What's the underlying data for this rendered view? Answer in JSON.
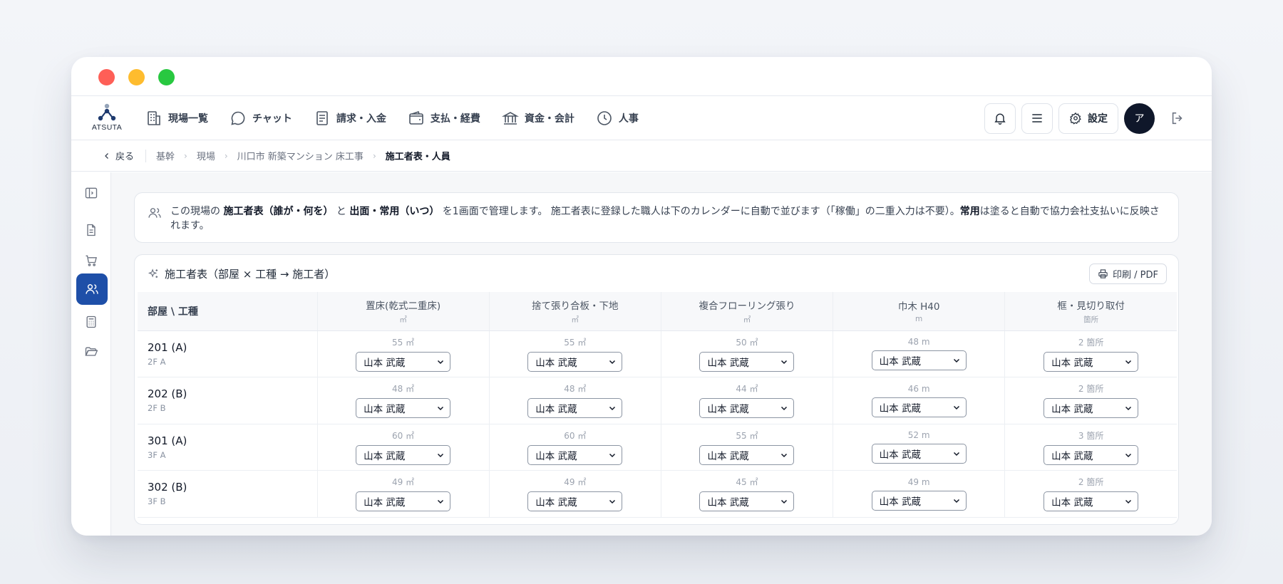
{
  "nav": {
    "logo_text": "ATSUTA",
    "items": [
      {
        "label": "現場一覧",
        "icon": "building-icon"
      },
      {
        "label": "チャット",
        "icon": "chat-bubble-icon"
      },
      {
        "label": "請求・入金",
        "icon": "invoice-icon"
      },
      {
        "label": "支払・経費",
        "icon": "wallet-icon"
      },
      {
        "label": "資金・会計",
        "icon": "bank-icon"
      },
      {
        "label": "人事",
        "icon": "clock-icon"
      }
    ],
    "settings_label": "設定",
    "avatar_initial": "ア"
  },
  "breadcrumb": {
    "back_label": "戻る",
    "items": [
      "基幹",
      "現場",
      "川口市 新築マンション 床工事"
    ],
    "current": "施工者表・人員"
  },
  "info": {
    "t1": "この現場の ",
    "b1": "施工者表（誰が・何を）",
    "t2": " と ",
    "b2": "出面・常用（いつ）",
    "t3": " を1画面で管理します。 施工者表に登録した職人は下のカレンダーに自動で並びます（「稼働」の二重入力は不要）。",
    "b3": "常用",
    "t4": "は塗ると自動で協力会社支払いに反映されます。"
  },
  "table_card": {
    "title": "施工者表（部屋 × 工種 → 施工者）",
    "print_label": "印刷 / PDF",
    "corner_header": "部屋 \\ 工種",
    "processes": [
      {
        "name": "置床(乾式二重床)",
        "unit": "㎡"
      },
      {
        "name": "捨て張り合板・下地",
        "unit": "㎡"
      },
      {
        "name": "複合フローリング張り",
        "unit": "㎡"
      },
      {
        "name": "巾木 H40",
        "unit": "m"
      },
      {
        "name": "框・見切り取付",
        "unit": "箇所"
      }
    ],
    "rows": [
      {
        "room": "201 (A)",
        "floor": "2F A",
        "cells": [
          {
            "qty": "55 ㎡",
            "worker": "山本 武蔵"
          },
          {
            "qty": "55 ㎡",
            "worker": "山本 武蔵"
          },
          {
            "qty": "50 ㎡",
            "worker": "山本 武蔵"
          },
          {
            "qty": "48 m",
            "worker": "山本 武蔵"
          },
          {
            "qty": "2 箇所",
            "worker": "山本 武蔵"
          }
        ]
      },
      {
        "room": "202 (B)",
        "floor": "2F B",
        "cells": [
          {
            "qty": "48 ㎡",
            "worker": "山本 武蔵"
          },
          {
            "qty": "48 ㎡",
            "worker": "山本 武蔵"
          },
          {
            "qty": "44 ㎡",
            "worker": "山本 武蔵"
          },
          {
            "qty": "46 m",
            "worker": "山本 武蔵"
          },
          {
            "qty": "2 箇所",
            "worker": "山本 武蔵"
          }
        ]
      },
      {
        "room": "301 (A)",
        "floor": "3F A",
        "cells": [
          {
            "qty": "60 ㎡",
            "worker": "山本 武蔵"
          },
          {
            "qty": "60 ㎡",
            "worker": "山本 武蔵"
          },
          {
            "qty": "55 ㎡",
            "worker": "山本 武蔵"
          },
          {
            "qty": "52 m",
            "worker": "山本 武蔵"
          },
          {
            "qty": "3 箇所",
            "worker": "山本 武蔵"
          }
        ]
      },
      {
        "room": "302 (B)",
        "floor": "3F B",
        "cells": [
          {
            "qty": "49 ㎡",
            "worker": "山本 武蔵"
          },
          {
            "qty": "49 ㎡",
            "worker": "山本 武蔵"
          },
          {
            "qty": "45 ㎡",
            "worker": "山本 武蔵"
          },
          {
            "qty": "49 m",
            "worker": "山本 武蔵"
          },
          {
            "qty": "2 箇所",
            "worker": "山本 武蔵"
          }
        ]
      }
    ]
  },
  "colors": {
    "accent": "#1e4fa8",
    "avatar_bg": "#0f172a"
  }
}
